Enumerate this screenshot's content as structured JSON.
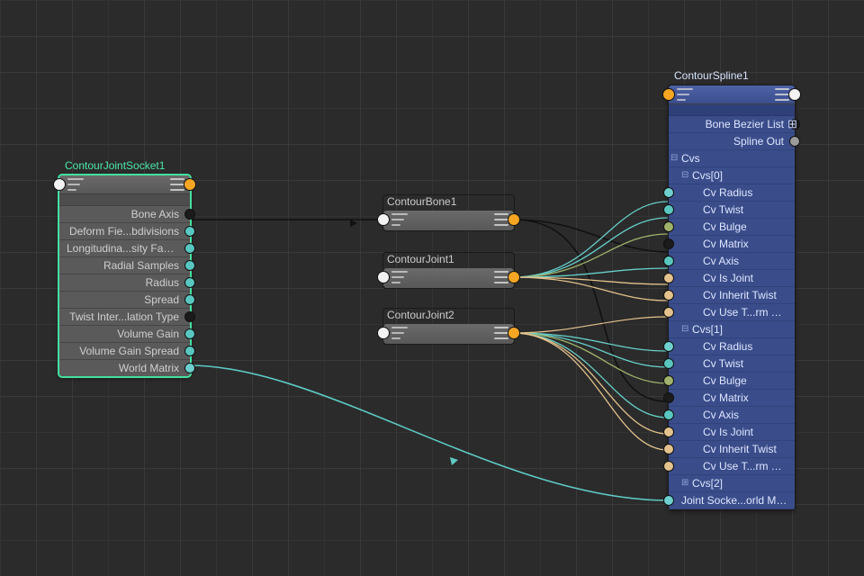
{
  "nodes": {
    "socket": {
      "title": "ContourJointSocket1",
      "rows": [
        {
          "label": "Bone Axis",
          "port": "black"
        },
        {
          "label": "Deform Fie...bdivisions",
          "port": "teal"
        },
        {
          "label": "Longitudina...sity Factor",
          "port": "teal"
        },
        {
          "label": "Radial Samples",
          "port": "teal"
        },
        {
          "label": "Radius",
          "port": "teal"
        },
        {
          "label": "Spread",
          "port": "teal"
        },
        {
          "label": "Twist Inter...lation Type",
          "port": "black"
        },
        {
          "label": "Volume Gain",
          "port": "teal"
        },
        {
          "label": "Volume Gain Spread",
          "port": "teal"
        },
        {
          "label": "World Matrix",
          "port": "ltteal"
        }
      ]
    },
    "bone": {
      "title": "ContourBone1"
    },
    "joint1": {
      "title": "ContourJoint1"
    },
    "joint2": {
      "title": "ContourJoint2"
    },
    "spline": {
      "title": "ContourSpline1",
      "rows": [
        {
          "label": "Bone Bezier List",
          "side": "right",
          "port": "black",
          "expander": "plus"
        },
        {
          "label": "Spline Out",
          "side": "right",
          "port": "grey"
        },
        {
          "label": "Cvs",
          "side": "left",
          "port": null,
          "tree": "minus",
          "depth": 0
        },
        {
          "label": "Cvs[0]",
          "side": "left",
          "port": null,
          "tree": "minus",
          "depth": 1
        },
        {
          "label": "Cv Radius",
          "side": "left",
          "port": "ltteal",
          "depth": 2
        },
        {
          "label": "Cv Twist",
          "side": "left",
          "port": "teal",
          "depth": 2
        },
        {
          "label": "Cv Bulge",
          "side": "left",
          "port": "olive",
          "depth": 2
        },
        {
          "label": "Cv Matrix",
          "side": "left",
          "port": "black",
          "depth": 2
        },
        {
          "label": "Cv Axis",
          "side": "left",
          "port": "teal",
          "depth": 2
        },
        {
          "label": "Cv Is Joint",
          "side": "left",
          "port": "tan",
          "depth": 2
        },
        {
          "label": "Cv Inherit Twist",
          "side": "left",
          "port": "tan",
          "depth": 2
        },
        {
          "label": "Cv Use T...rm Twist",
          "side": "left",
          "port": "tan",
          "depth": 2
        },
        {
          "label": "Cvs[1]",
          "side": "left",
          "port": null,
          "tree": "minus",
          "depth": 1
        },
        {
          "label": "Cv Radius",
          "side": "left",
          "port": "ltteal",
          "depth": 2
        },
        {
          "label": "Cv Twist",
          "side": "left",
          "port": "teal",
          "depth": 2
        },
        {
          "label": "Cv Bulge",
          "side": "left",
          "port": "olive",
          "depth": 2
        },
        {
          "label": "Cv Matrix",
          "side": "left",
          "port": "black",
          "depth": 2
        },
        {
          "label": "Cv Axis",
          "side": "left",
          "port": "teal",
          "depth": 2
        },
        {
          "label": "Cv Is Joint",
          "side": "left",
          "port": "tan",
          "depth": 2
        },
        {
          "label": "Cv Inherit Twist",
          "side": "left",
          "port": "tan",
          "depth": 2
        },
        {
          "label": "Cv Use T...rm Twist",
          "side": "left",
          "port": "tan",
          "depth": 2
        },
        {
          "label": "Cvs[2]",
          "side": "left",
          "port": null,
          "tree": "plus",
          "depth": 1
        },
        {
          "label": "Joint Socke...orld Matrix",
          "side": "left",
          "port": "ltteal",
          "depth": 0
        }
      ]
    }
  },
  "port_colors": {
    "black": "c-black",
    "teal": "c-teal",
    "ltteal": "c-ltteal",
    "olive": "c-olive",
    "tan": "c-tan",
    "grey": "c-grey",
    "white": "c-white",
    "orange": "c-orange"
  }
}
